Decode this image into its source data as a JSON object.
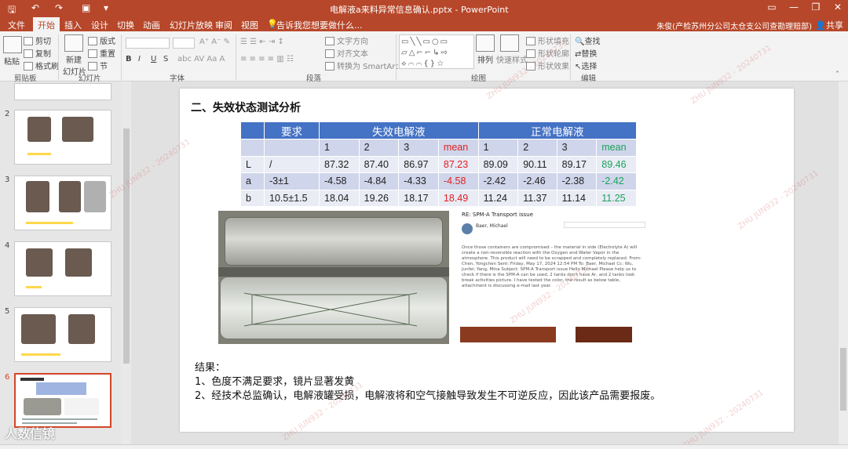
{
  "titlebar": {
    "title": "电解液a来料异常信息确认.pptx - PowerPoint",
    "save_icon": "save-icon",
    "undo_icon": "undo-icon",
    "redo_icon": "redo-icon",
    "present_icon": "present-icon",
    "customize_icon": "customize-icon",
    "min": "—",
    "restore": "▢",
    "max": "❐",
    "close": "✕"
  },
  "tabs": {
    "items": [
      "文件",
      "开始",
      "插入",
      "设计",
      "切换",
      "动画",
      "幻灯片放映",
      "审阅",
      "视图"
    ],
    "tell_me": "告诉我您想要做什么...",
    "user": "朱俊(产检苏州分公司太仓支公司查勘理赔部)",
    "share": "共享"
  },
  "ribbon": {
    "paste": "粘贴",
    "cut": "剪切",
    "copy": "复制",
    "format_painter": "格式刷",
    "clipboard": "剪贴板",
    "new_slide": "新建",
    "new_slide2": "幻灯片",
    "layout": "版式",
    "reset": "重置",
    "section": "节",
    "slides": "幻灯片",
    "font": "字体",
    "text_direction": "文字方向",
    "align_text": "对齐文本",
    "smartart": "转换为 SmartArt",
    "paragraph": "段落",
    "arrange": "排列",
    "quick_styles": "快速样式",
    "shape_fill": "形状填充",
    "shape_outline": "形状轮廓",
    "shape_effects": "形状效果",
    "drawing": "绘图",
    "find": "查找",
    "replace": "替换",
    "select": "选择",
    "editing": "编辑",
    "bold": "B",
    "italic": "I",
    "underline": "U",
    "strike": "S"
  },
  "slides": [
    {
      "num": "2"
    },
    {
      "num": "3"
    },
    {
      "num": "4"
    },
    {
      "num": "5"
    },
    {
      "num": "6"
    }
  ],
  "slide": {
    "heading": "二、失效状态测试分析",
    "table": {
      "headers": [
        "要求",
        "失效电解液",
        "正常电解液"
      ],
      "subheaders": [
        "",
        "",
        "1",
        "2",
        "3",
        "mean",
        "1",
        "2",
        "3",
        "mean"
      ],
      "rows": [
        [
          "L",
          "/",
          "87.32",
          "87.40",
          "86.97",
          "87.23",
          "89.09",
          "90.11",
          "89.17",
          "89.46"
        ],
        [
          "a",
          "-3±1",
          "-4.58",
          "-4.84",
          "-4.33",
          "-4.58",
          "-2.42",
          "-2.46",
          "-2.38",
          "-2.42"
        ],
        [
          "b",
          "10.5±1.5",
          "18.04",
          "19.26",
          "18.17",
          "18.49",
          "11.24",
          "11.37",
          "11.14",
          "11.25"
        ]
      ]
    },
    "email": {
      "subject": "RE: SPM-A Transport issue",
      "sender": "Baer, Michael",
      "body": "Once those containers are compromised – the material in side (Electrolyte A) will create a non-reversible reaction with the Oxygen and Water Vapor in the atmosphere. This product will need to be scrapped and completely replaced.\nFrom: Chen, Yongchen\nSent: Friday, May 17, 2024 12:54 PM\nTo: Baer, Michael\nCc: Wu, Junfei; Yang, Mina\nSubject: SPM-A Transport issue\nHello Michael\nPlease help us to check if there is the SPM-A can be used, 2 tanks don't have Ar, and 2 tanks look break activities picture. I have tested the color, the result as below table, attachment is discussing e-mail last year."
    },
    "results": {
      "title": "结果：",
      "line1": "1、色度不满足要求，镜片显著发黄",
      "line2": "2、经技术总监确认，电解液罐受损，电解液将和空气接触导致发生不可逆反应，因此该产品需要报废。"
    }
  },
  "watermark": "ZHU JUN932 - 20240731",
  "logo": "人数信镜"
}
